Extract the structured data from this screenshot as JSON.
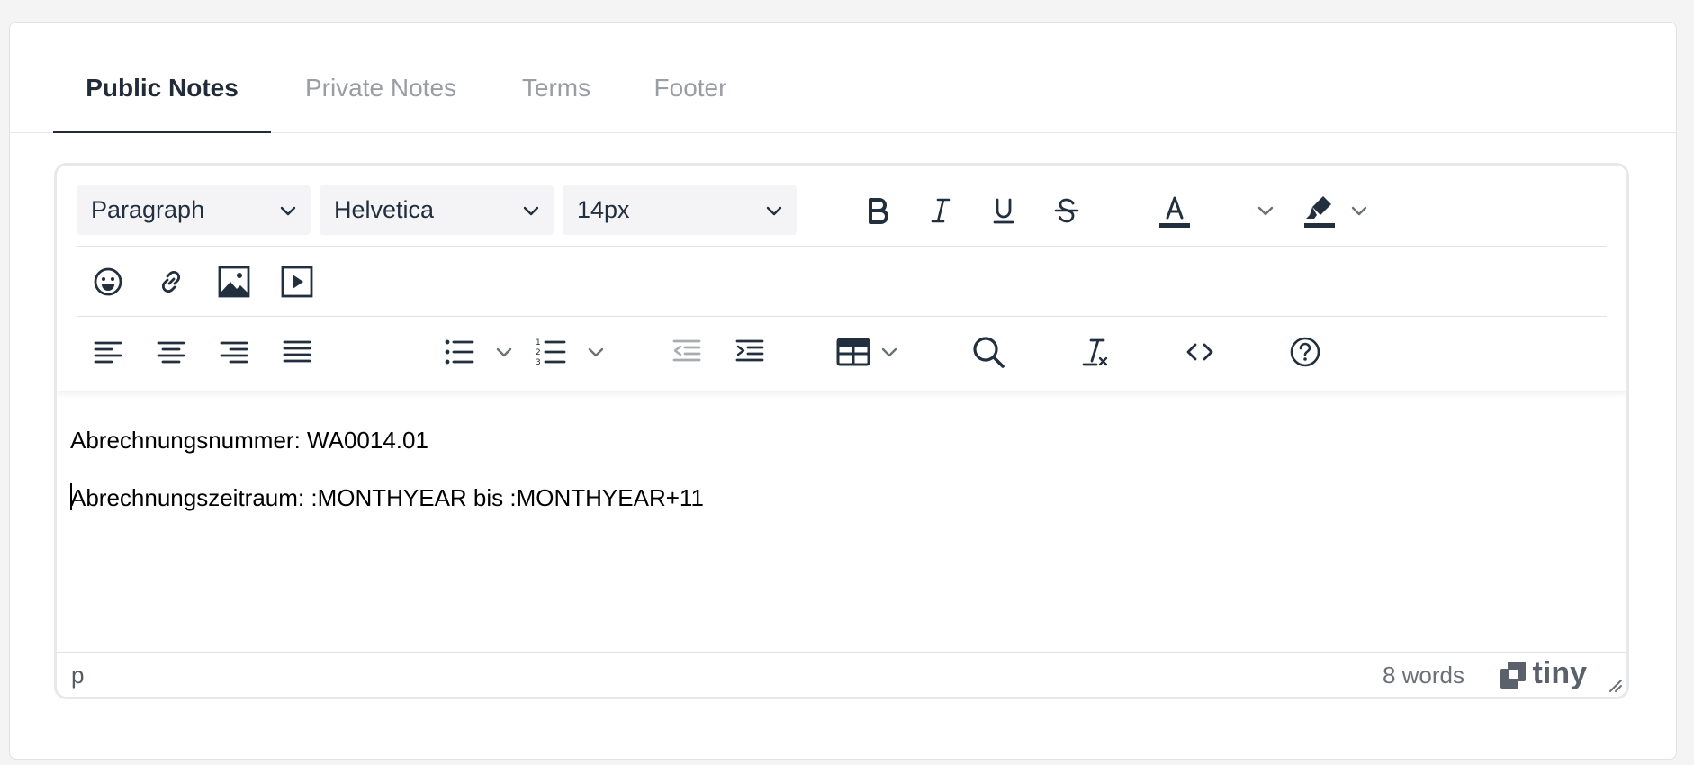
{
  "tabs": [
    {
      "label": "Public Notes",
      "active": true
    },
    {
      "label": "Private Notes",
      "active": false
    },
    {
      "label": "Terms",
      "active": false
    },
    {
      "label": "Footer",
      "active": false
    }
  ],
  "toolbar": {
    "block_format": "Paragraph",
    "font_family": "Helvetica",
    "font_size": "14px",
    "icons_row1": [
      "bold-icon",
      "italic-icon",
      "underline-icon",
      "strikethrough-icon",
      "text-color-icon",
      "highlight-color-icon"
    ],
    "icons_row2": [
      "emoji-icon",
      "link-icon",
      "image-icon",
      "media-icon"
    ],
    "icons_row3": [
      "align-left-icon",
      "align-center-icon",
      "align-right-icon",
      "align-justify-icon",
      "bullet-list-icon",
      "numbered-list-icon",
      "outdent-icon",
      "indent-icon",
      "table-icon",
      "search-icon",
      "clear-format-icon",
      "source-code-icon",
      "help-icon"
    ]
  },
  "content": {
    "line1": "Abrechnungsnummer: WA0014.01",
    "line2": "Abrechnungszeitraum: :MONTHYEAR bis :MONTHYEAR+11"
  },
  "statusbar": {
    "path": "p",
    "word_count": "8 words",
    "brand": "tiny"
  },
  "colors": {
    "active_tab": "#222b38",
    "inactive_tab": "#9a9da3",
    "toolbar_icon": "#222f3e",
    "disabled_icon": "#a8abb0"
  }
}
